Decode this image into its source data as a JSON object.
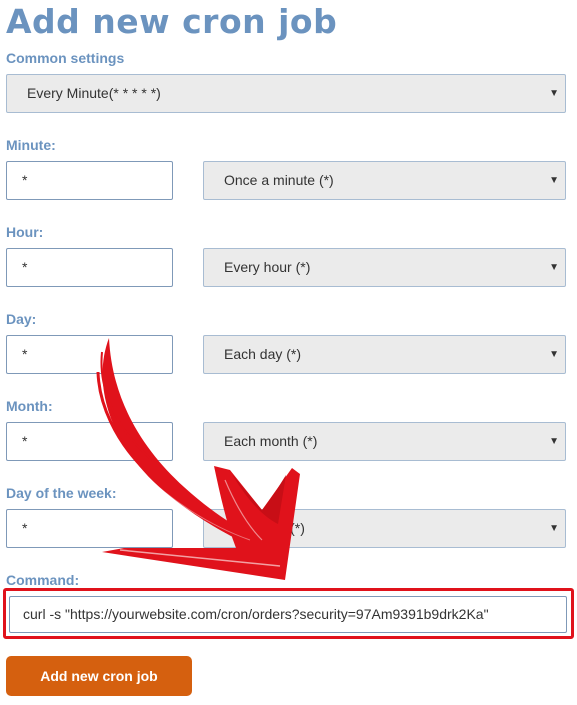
{
  "page": {
    "title": "Add new cron job"
  },
  "common": {
    "label": "Common settings",
    "value": "Every Minute(* * * * *)"
  },
  "fields": {
    "minute": {
      "label": "Minute:",
      "value": "*",
      "select": "Once a minute (*)"
    },
    "hour": {
      "label": "Hour:",
      "value": "*",
      "select": "Every hour (*)"
    },
    "day": {
      "label": "Day:",
      "value": "*",
      "select": "Each day (*)"
    },
    "month": {
      "label": "Month:",
      "value": "*",
      "select": "Each month (*)"
    },
    "weekday": {
      "label": "Day of the week:",
      "value": "*",
      "select": "Every day (*)"
    }
  },
  "command": {
    "label": "Command:",
    "value": "curl -s \"https://yourwebsite.com/cron/orders?security=97Am9391b9drk2Ka\""
  },
  "submit": {
    "label": "Add new cron job"
  },
  "icons": {
    "dropdown": "chevron-down-icon",
    "annotation": "red-arrow-icon"
  },
  "colors": {
    "heading": "#6b93bf",
    "button": "#d5600f",
    "highlight": "#e0121b"
  }
}
